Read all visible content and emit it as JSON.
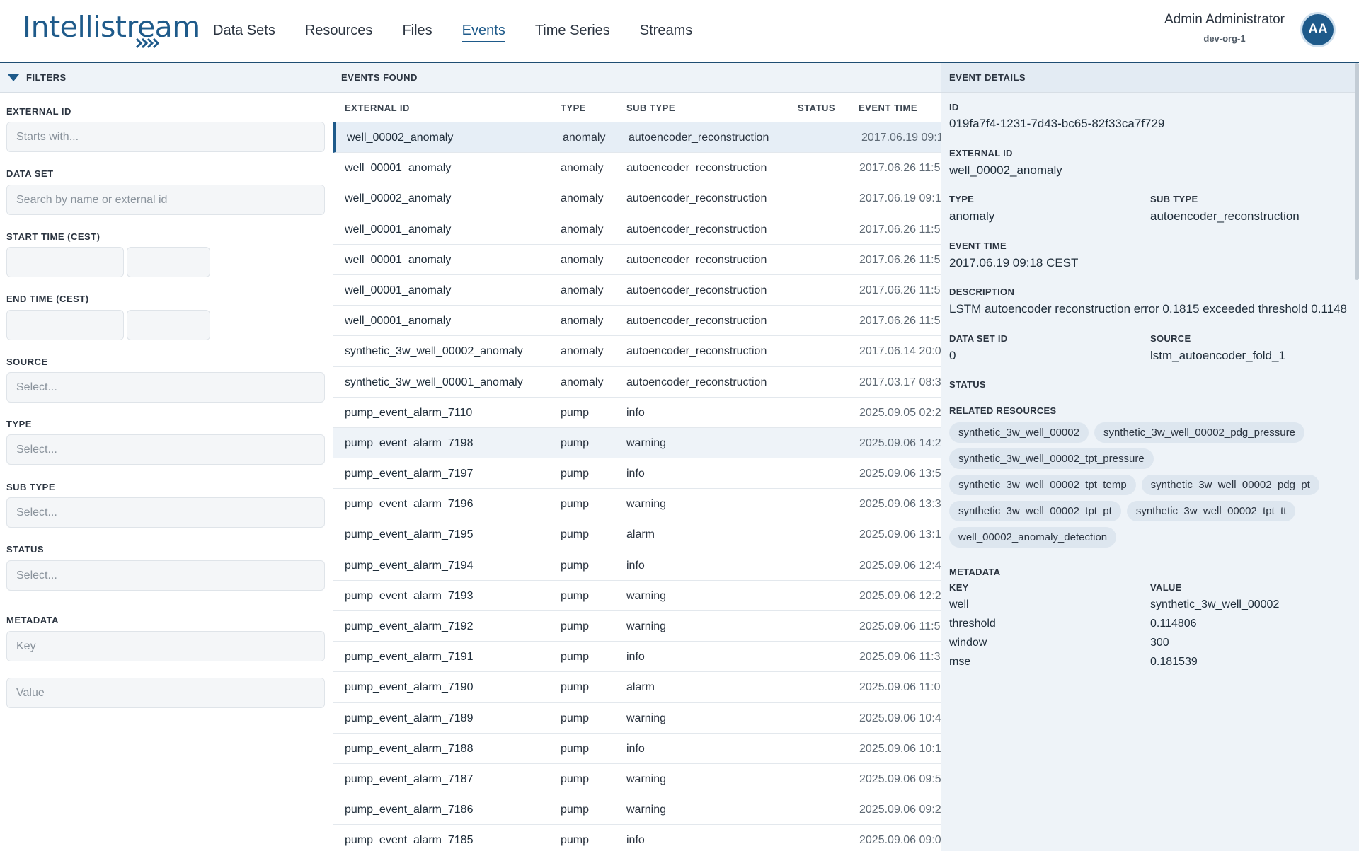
{
  "header": {
    "logo_text": "Intellistream",
    "nav": [
      "Data Sets",
      "Resources",
      "Files",
      "Events",
      "Time Series",
      "Streams"
    ],
    "active_nav": "Events",
    "user_name": "Admin Administrator",
    "user_org": "dev-org-1",
    "avatar_initials": "AA"
  },
  "filters": {
    "title": "FILTERS",
    "external_id": {
      "label": "EXTERNAL ID",
      "placeholder": "Starts with..."
    },
    "data_set": {
      "label": "DATA SET",
      "placeholder": "Search by name or external id"
    },
    "start_time": {
      "label": "START TIME (CEST)"
    },
    "end_time": {
      "label": "END TIME (CEST)"
    },
    "source": {
      "label": "SOURCE",
      "placeholder": "Select..."
    },
    "type": {
      "label": "TYPE",
      "placeholder": "Select..."
    },
    "sub_type": {
      "label": "SUB TYPE",
      "placeholder": "Select..."
    },
    "status": {
      "label": "STATUS",
      "placeholder": "Select..."
    },
    "metadata": {
      "label": "METADATA",
      "key_placeholder": "Key",
      "value_placeholder": "Value"
    }
  },
  "events": {
    "title": "EVENTS FOUND",
    "columns": [
      "EXTERNAL ID",
      "TYPE",
      "SUB TYPE",
      "STATUS",
      "EVENT TIME"
    ],
    "rows": [
      {
        "ext": "well_00002_anomaly",
        "type": "anomaly",
        "sub": "autoencoder_reconstruction",
        "time": "2017.06.19 09:1"
      },
      {
        "ext": "well_00001_anomaly",
        "type": "anomaly",
        "sub": "autoencoder_reconstruction",
        "time": "2017.06.26 11:5"
      },
      {
        "ext": "well_00002_anomaly",
        "type": "anomaly",
        "sub": "autoencoder_reconstruction",
        "time": "2017.06.19 09:1"
      },
      {
        "ext": "well_00001_anomaly",
        "type": "anomaly",
        "sub": "autoencoder_reconstruction",
        "time": "2017.06.26 11:5"
      },
      {
        "ext": "well_00001_anomaly",
        "type": "anomaly",
        "sub": "autoencoder_reconstruction",
        "time": "2017.06.26 11:5"
      },
      {
        "ext": "well_00001_anomaly",
        "type": "anomaly",
        "sub": "autoencoder_reconstruction",
        "time": "2017.06.26 11:5"
      },
      {
        "ext": "well_00001_anomaly",
        "type": "anomaly",
        "sub": "autoencoder_reconstruction",
        "time": "2017.06.26 11:5"
      },
      {
        "ext": "synthetic_3w_well_00002_anomaly",
        "type": "anomaly",
        "sub": "autoencoder_reconstruction",
        "time": "2017.06.14 20:0"
      },
      {
        "ext": "synthetic_3w_well_00001_anomaly",
        "type": "anomaly",
        "sub": "autoencoder_reconstruction",
        "time": "2017.03.17 08:3"
      },
      {
        "ext": "pump_event_alarm_7110",
        "type": "pump",
        "sub": "info",
        "time": "2025.09.05 02:2"
      },
      {
        "ext": "pump_event_alarm_7198",
        "type": "pump",
        "sub": "warning",
        "time": "2025.09.06 14:2"
      },
      {
        "ext": "pump_event_alarm_7197",
        "type": "pump",
        "sub": "info",
        "time": "2025.09.06 13:5"
      },
      {
        "ext": "pump_event_alarm_7196",
        "type": "pump",
        "sub": "warning",
        "time": "2025.09.06 13:3"
      },
      {
        "ext": "pump_event_alarm_7195",
        "type": "pump",
        "sub": "alarm",
        "time": "2025.09.06 13:1"
      },
      {
        "ext": "pump_event_alarm_7194",
        "type": "pump",
        "sub": "info",
        "time": "2025.09.06 12:4"
      },
      {
        "ext": "pump_event_alarm_7193",
        "type": "pump",
        "sub": "warning",
        "time": "2025.09.06 12:2"
      },
      {
        "ext": "pump_event_alarm_7192",
        "type": "pump",
        "sub": "warning",
        "time": "2025.09.06 11:5"
      },
      {
        "ext": "pump_event_alarm_7191",
        "type": "pump",
        "sub": "info",
        "time": "2025.09.06 11:3"
      },
      {
        "ext": "pump_event_alarm_7190",
        "type": "pump",
        "sub": "alarm",
        "time": "2025.09.06 11:0"
      },
      {
        "ext": "pump_event_alarm_7189",
        "type": "pump",
        "sub": "warning",
        "time": "2025.09.06 10:4"
      },
      {
        "ext": "pump_event_alarm_7188",
        "type": "pump",
        "sub": "info",
        "time": "2025.09.06 10:1"
      },
      {
        "ext": "pump_event_alarm_7187",
        "type": "pump",
        "sub": "warning",
        "time": "2025.09.06 09:5"
      },
      {
        "ext": "pump_event_alarm_7186",
        "type": "pump",
        "sub": "warning",
        "time": "2025.09.06 09:2"
      },
      {
        "ext": "pump_event_alarm_7185",
        "type": "pump",
        "sub": "info",
        "time": "2025.09.06 09:0"
      }
    ]
  },
  "details": {
    "title": "EVENT DETAILS",
    "id_label": "ID",
    "id": "019fa7f4-1231-7d43-bc65-82f33ca7f729",
    "ext_label": "EXTERNAL ID",
    "ext": "well_00002_anomaly",
    "type_label": "TYPE",
    "type": "anomaly",
    "sub_label": "SUB TYPE",
    "sub": "autoencoder_reconstruction",
    "time_label": "EVENT TIME",
    "time": "2017.06.19 09:18 CEST",
    "desc_label": "DESCRIPTION",
    "desc": "LSTM autoencoder reconstruction error 0.1815 exceeded threshold 0.1148",
    "dsid_label": "DATA SET ID",
    "dsid": "0",
    "source_label": "SOURCE",
    "source": "lstm_autoencoder_fold_1",
    "status_label": "STATUS",
    "related_label": "RELATED RESOURCES",
    "related": [
      "synthetic_3w_well_00002",
      "synthetic_3w_well_00002_pdg_pressure",
      "synthetic_3w_well_00002_tpt_pressure",
      "synthetic_3w_well_00002_tpt_temp",
      "synthetic_3w_well_00002_pdg_pt",
      "synthetic_3w_well_00002_tpt_pt",
      "synthetic_3w_well_00002_tpt_tt",
      "well_00002_anomaly_detection"
    ],
    "metadata_label": "METADATA",
    "key_label": "KEY",
    "value_label": "VALUE",
    "metadata": [
      {
        "key": "well",
        "value": "synthetic_3w_well_00002"
      },
      {
        "key": "threshold",
        "value": "0.114806"
      },
      {
        "key": "window",
        "value": "300"
      },
      {
        "key": "mse",
        "value": "0.181539"
      }
    ]
  }
}
